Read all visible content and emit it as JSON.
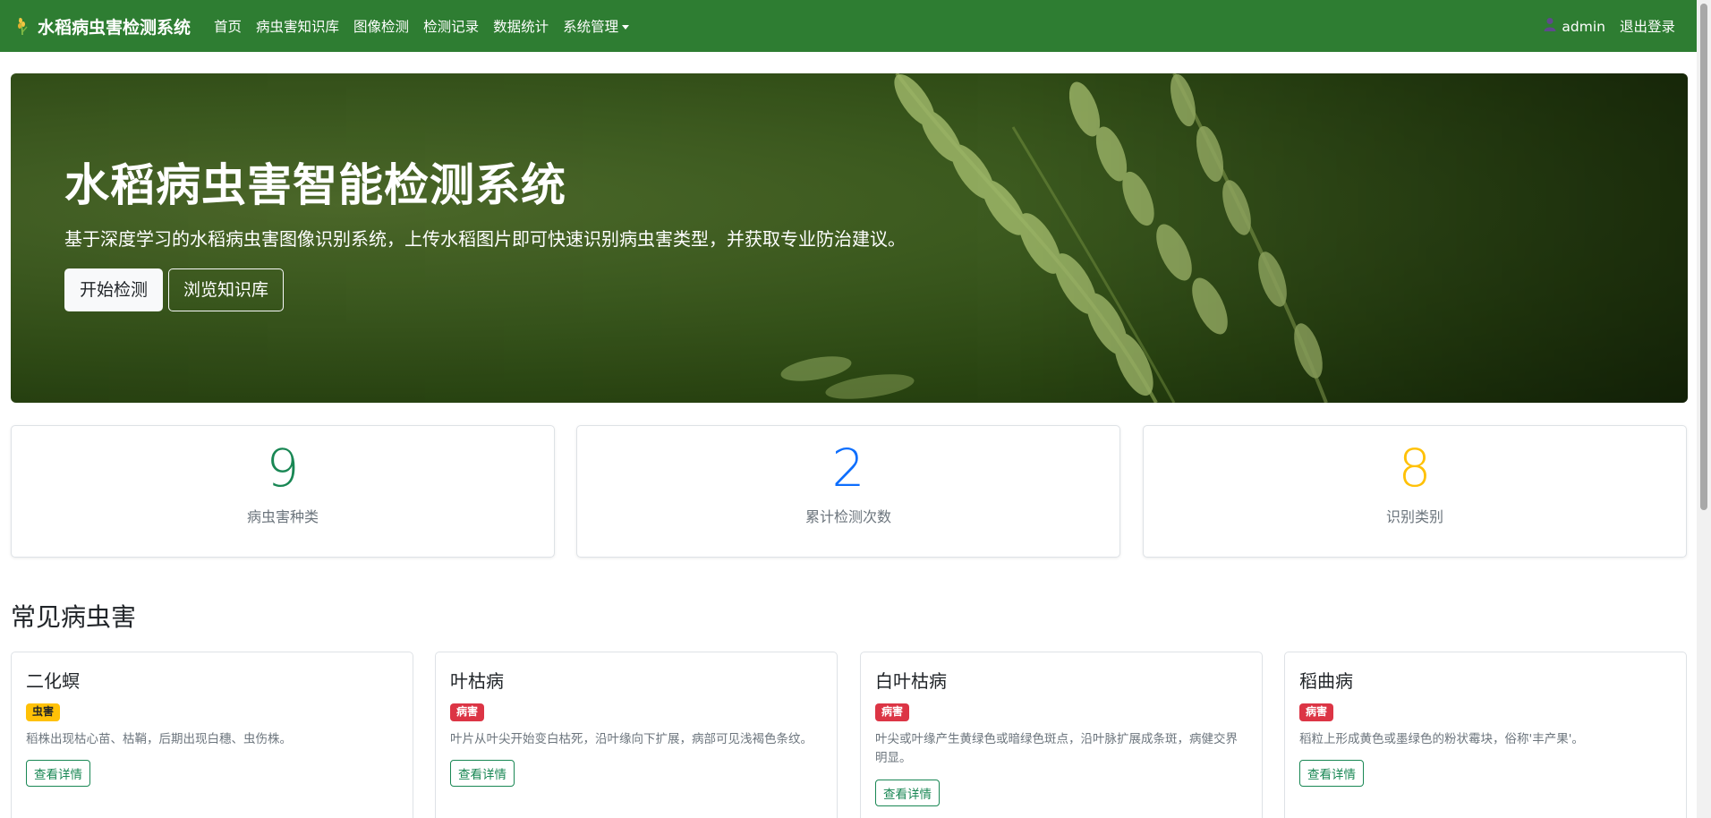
{
  "navbar": {
    "brand": "水稻病虫害检测系统",
    "brand_icon": "rice-icon",
    "links": [
      "首页",
      "病虫害知识库",
      "图像检测",
      "检测记录",
      "数据统计",
      "系统管理"
    ],
    "user_icon": "user-icon",
    "username": "admin",
    "logout": "退出登录",
    "color": "#2e7d32"
  },
  "hero": {
    "title": "水稻病虫害智能检测系统",
    "subtitle": "基于深度学习的水稻病虫害图像识别系统，上传水稻图片即可快速识别病虫害类型，并获取专业防治建议。",
    "primary_button": "开始检测",
    "secondary_button": "浏览知识库"
  },
  "stats": [
    {
      "value": "9",
      "label": "病虫害种类",
      "color": "#198754"
    },
    {
      "value": "2",
      "label": "累计检测次数",
      "color": "#0d6efd"
    },
    {
      "value": "8",
      "label": "识别类别",
      "color": "#ffc107"
    }
  ],
  "section": {
    "title": "常见病虫害"
  },
  "pests": [
    {
      "name": "二化螟",
      "badge": "虫害",
      "type": "pest",
      "desc": "稻株出现枯心苗、枯鞘，后期出现白穗、虫伤株。",
      "button": "查看详情"
    },
    {
      "name": "叶枯病",
      "badge": "病害",
      "type": "disease",
      "desc": "叶片从叶尖开始变白枯死，沿叶缘向下扩展，病部可见浅褐色条纹。",
      "button": "查看详情"
    },
    {
      "name": "白叶枯病",
      "badge": "病害",
      "type": "disease",
      "desc": "叶尖或叶缘产生黄绿色或暗绿色斑点，沿叶脉扩展成条斑，病健交界明显。",
      "button": "查看详情"
    },
    {
      "name": "稻曲病",
      "badge": "病害",
      "type": "disease",
      "desc": "稻粒上形成黄色或墨绿色的粉状霉块，俗称'丰产果'。",
      "button": "查看详情"
    }
  ]
}
